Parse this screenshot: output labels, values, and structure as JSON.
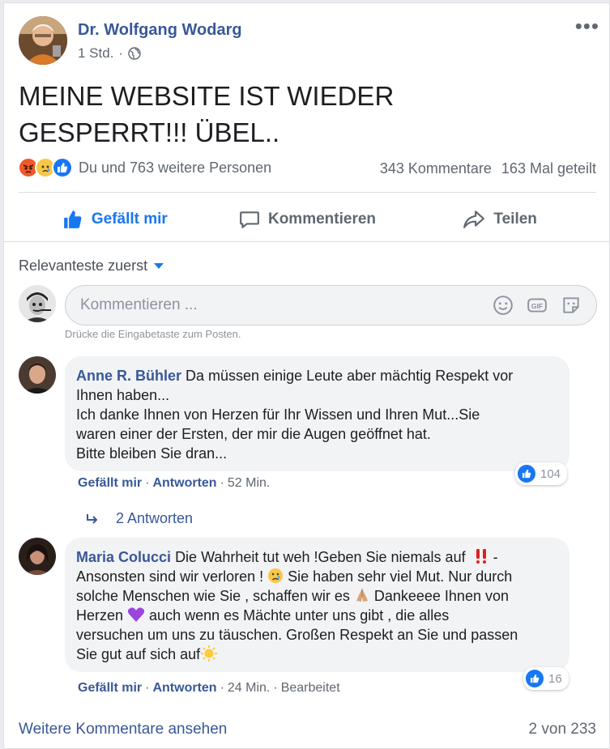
{
  "post": {
    "author": "Dr. Wolfgang Wodarg",
    "time": "1 Std.",
    "privacy_icon": "globe-icon",
    "text_line1": "MEINE WEBSITE IST WIEDER",
    "text_line2": "GESPERRT!!! ÜBEL..",
    "reactions_text": "Du und 763 weitere Personen",
    "comments_count": "343 Kommentare",
    "shares_count": "163 Mal geteilt"
  },
  "actions": {
    "like": "Gefällt mir",
    "comment": "Kommentieren",
    "share": "Teilen"
  },
  "sort_label": "Relevanteste zuerst",
  "composer": {
    "placeholder": "Kommentieren ...",
    "hint": "Drücke die Eingabetaste zum Posten."
  },
  "comments": [
    {
      "name": "Anne R. Bühler",
      "text_first": "Da müssen einige Leute aber mächtig Respekt vor",
      "lines": [
        "Ihnen haben...",
        "Ich danke Ihnen von Herzen für Ihr Wissen und Ihren Mut...Sie",
        "waren einer der Ersten, der mir die Augen geöffnet hat.",
        "Bitte bleiben Sie dran..."
      ],
      "likes": "104",
      "like_label": "Gefällt mir",
      "reply_label": "Antworten",
      "time": "52 Min.",
      "replies_label": "2 Antworten"
    },
    {
      "name": "Maria Colucci",
      "text_first": "Die Wahrheit tut weh !Geben Sie niemals auf",
      "text_first_tail": " -",
      "line2a": "Ansonsten sind wir verloren !",
      "line2b": " Sie haben sehr viel Mut. Nur durch",
      "line3a": "solche Menschen wie Sie , schaffen wir es",
      "line3b": " Dankeeee Ihnen von",
      "line4a": "Herzen",
      "line4b": " auch wenn es Mächte unter uns gibt , die alles",
      "line5": "versuchen um uns zu täuschen. Großen Respekt an Sie und passen",
      "line6": "Sie gut auf sich auf",
      "likes": "16",
      "like_label": "Gefällt mir",
      "reply_label": "Antworten",
      "time": "24 Min.",
      "edited": "Bearbeitet"
    }
  ],
  "footer": {
    "more_comments": "Weitere Kommentare ansehen",
    "pagination": "2 von 233"
  },
  "colors": {
    "link_blue": "#385898",
    "fb_blue": "#1877f2",
    "muted": "#606770",
    "bubble": "#f2f3f5"
  }
}
